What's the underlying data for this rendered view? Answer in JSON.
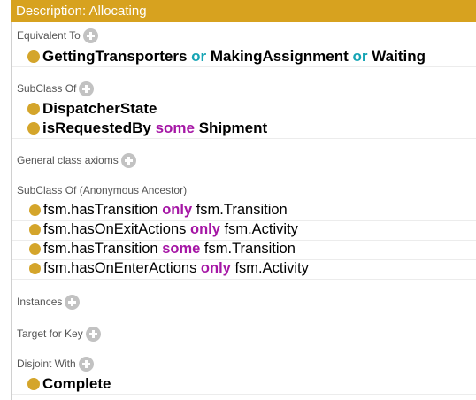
{
  "header": {
    "title": "Description: Allocating"
  },
  "sections": {
    "equivalent_to": "Equivalent To",
    "subclass_of": "SubClass Of",
    "general_axioms": "General class axioms",
    "anon_ancestor": "SubClass Of (Anonymous Ancestor)",
    "instances": "Instances",
    "target_for_key": "Target for Key",
    "disjoint_with": "Disjoint With"
  },
  "equivalent": {
    "t1": "GettingTransporters",
    "or1": "or",
    "t2": "MakingAssignment",
    "or2": "or",
    "t3": "Waiting"
  },
  "subclass": {
    "r1": "DispatcherState",
    "r2_prop": "isRequestedBy",
    "r2_kw": "some",
    "r2_cls": "Shipment"
  },
  "ancestors": [
    {
      "prop": "fsm.hasTransition",
      "kw": "only",
      "cls": "fsm.Transition"
    },
    {
      "prop": "fsm.hasOnExitActions",
      "kw": "only",
      "cls": "fsm.Activity"
    },
    {
      "prop": "fsm.hasTransition",
      "kw": "some",
      "cls": "fsm.Transition"
    },
    {
      "prop": "fsm.hasOnEnterActions",
      "kw": "only",
      "cls": "fsm.Activity"
    }
  ],
  "disjoint": {
    "r1": "Complete"
  },
  "colors": {
    "header_bg": "#d7a21f",
    "bullet": "#d4a52b",
    "keyword_or": "#15a4b4",
    "keyword_quantifier": "#a516a5"
  },
  "icons": {
    "add": "add-circle-icon",
    "bullet": "class-bullet-icon"
  }
}
